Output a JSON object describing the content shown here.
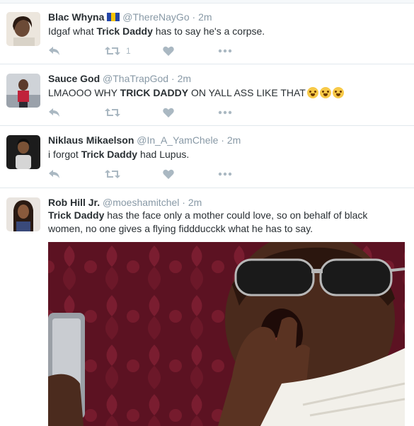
{
  "tweets": [
    {
      "name": "Blac Whyna",
      "handle": "@ThereNayGo",
      "time": "2m",
      "text_pre": "Idgaf what ",
      "text_bold": "Trick Daddy",
      "text_post": " has to say he's a corpse.",
      "retweet_count": "1"
    },
    {
      "name": "Sauce God",
      "handle": "@ThaTrapGod",
      "time": "2m",
      "text_pre": "LMAOOO WHY ",
      "text_bold": "TRICK DADDY",
      "text_post": " ON YALL ASS LIKE THAT",
      "retweet_count": ""
    },
    {
      "name": "Niklaus Mikaelson",
      "handle": "@In_A_YamChele",
      "time": "2m",
      "text_pre": "i forgot ",
      "text_bold": "Trick Daddy",
      "text_post": " had Lupus.",
      "retweet_count": ""
    },
    {
      "name": "Rob Hill Jr.",
      "handle": "@moeshamitchel",
      "time": "2m",
      "text_pre": "",
      "text_bold": "Trick Daddy",
      "text_post": " has the face only a mother could love, so on behalf of black women, no one gives a flying fiddducckk what he has to say.",
      "retweet_count": ""
    }
  ],
  "separator": "·",
  "colors": {
    "text": "#292f33",
    "muted": "#8899a6",
    "icon": "#aab8c2",
    "border": "#e1e8ed"
  },
  "icons": [
    "reply-icon",
    "retweet-icon",
    "like-heart-icon",
    "more-dots-icon",
    "barbados-flag-emoji",
    "crying-laughing-emoji"
  ]
}
